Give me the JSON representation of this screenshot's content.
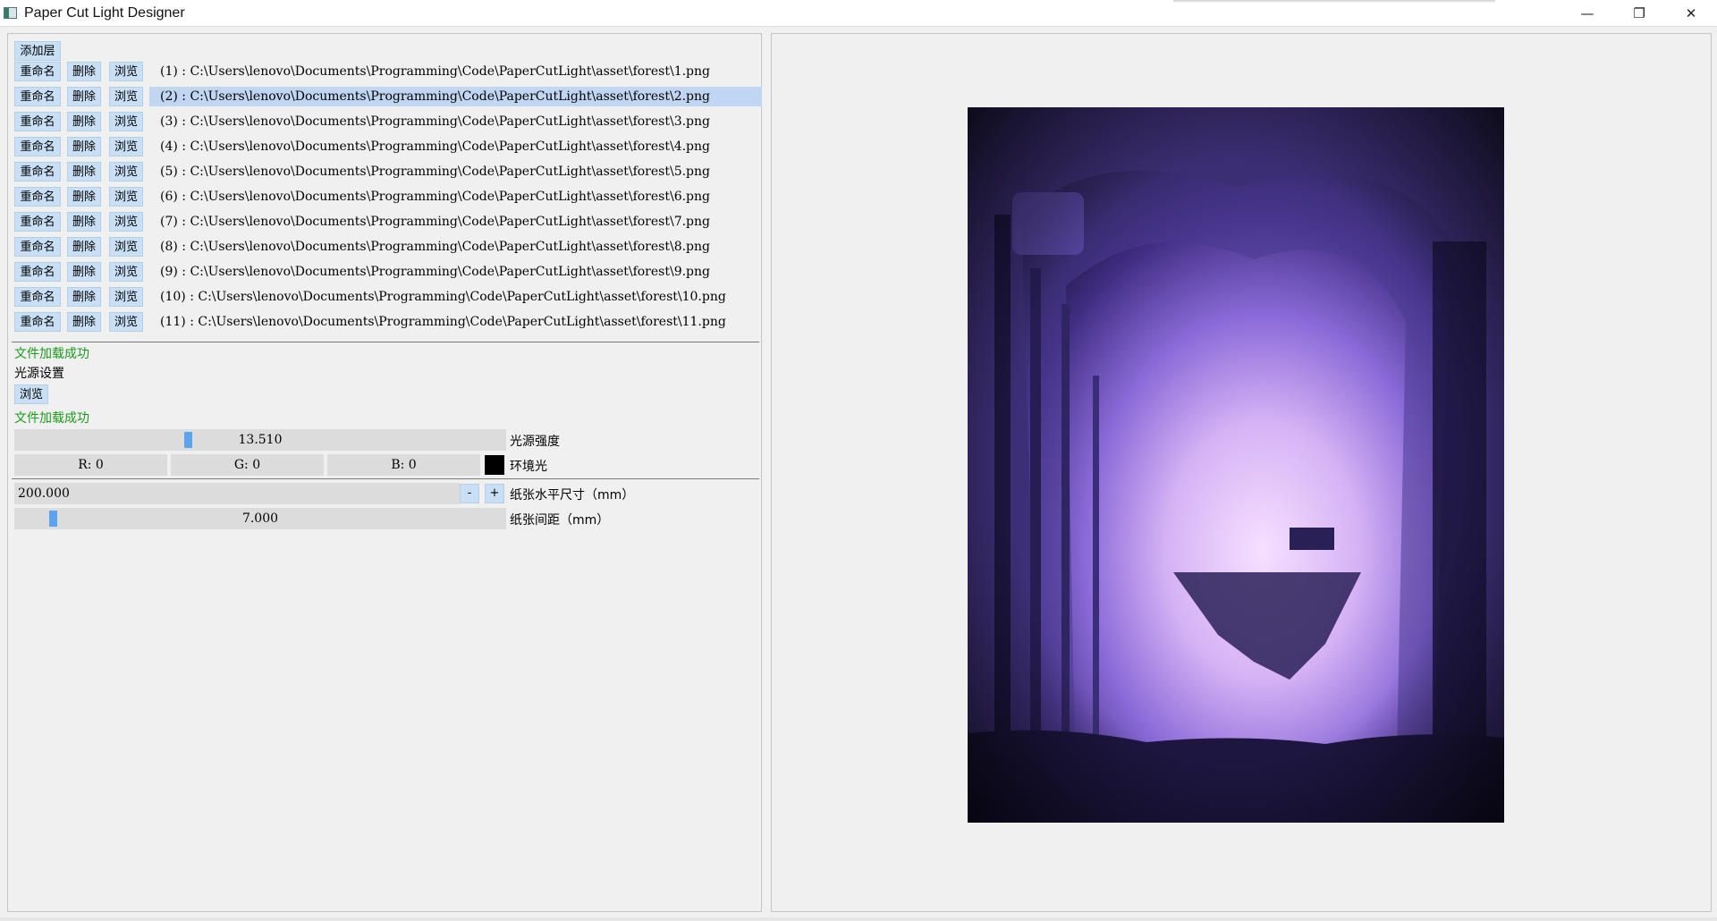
{
  "window": {
    "title": "Paper Cut Light Designer",
    "controls": {
      "minimize": "—",
      "restore": "❐",
      "close": "✕"
    }
  },
  "toolbar": {
    "add_layer": "添加层"
  },
  "layer_buttons": {
    "rename": "重命名",
    "delete": "删除",
    "browse": "浏览"
  },
  "layers": [
    {
      "path": "(1) : C:\\Users\\lenovo\\Documents\\Programming\\Code\\PaperCutLight\\asset\\forest\\1.png"
    },
    {
      "path": "(2) : C:\\Users\\lenovo\\Documents\\Programming\\Code\\PaperCutLight\\asset\\forest\\2.png"
    },
    {
      "path": "(3) : C:\\Users\\lenovo\\Documents\\Programming\\Code\\PaperCutLight\\asset\\forest\\3.png"
    },
    {
      "path": "(4) : C:\\Users\\lenovo\\Documents\\Programming\\Code\\PaperCutLight\\asset\\forest\\4.png"
    },
    {
      "path": "(5) : C:\\Users\\lenovo\\Documents\\Programming\\Code\\PaperCutLight\\asset\\forest\\5.png"
    },
    {
      "path": "(6) : C:\\Users\\lenovo\\Documents\\Programming\\Code\\PaperCutLight\\asset\\forest\\6.png"
    },
    {
      "path": "(7) : C:\\Users\\lenovo\\Documents\\Programming\\Code\\PaperCutLight\\asset\\forest\\7.png"
    },
    {
      "path": "(8) : C:\\Users\\lenovo\\Documents\\Programming\\Code\\PaperCutLight\\asset\\forest\\8.png"
    },
    {
      "path": "(9) : C:\\Users\\lenovo\\Documents\\Programming\\Code\\PaperCutLight\\asset\\forest\\9.png"
    },
    {
      "path": "(10) : C:\\Users\\lenovo\\Documents\\Programming\\Code\\PaperCutLight\\asset\\forest\\10.png"
    },
    {
      "path": "(11) : C:\\Users\\lenovo\\Documents\\Programming\\Code\\PaperCutLight\\asset\\forest\\11.png"
    }
  ],
  "selected_layer": 2,
  "status": {
    "layers_loaded": "文件加载成功"
  },
  "light": {
    "section_title": "光源设置",
    "browse": "浏览",
    "loaded": "文件加载成功",
    "intensity_value": "13.510",
    "intensity_label": "光源强度",
    "intensity_fraction": 0.35,
    "ambient": {
      "r": "R:  0",
      "g": "G:  0",
      "b": "B:  0",
      "label": "环境光",
      "color": "#000000"
    }
  },
  "paper": {
    "width_value": "200.000",
    "decrement": "-",
    "increment": "+",
    "width_label": "纸张水平尺寸（mm）",
    "spacing_value": "7.000",
    "spacing_label": "纸张间距（mm）",
    "spacing_fraction": 0.07
  },
  "colors": {
    "button_bg": "#c8dff5",
    "selected_row": "#c0d6f2",
    "success_text": "#1a9a1a",
    "slider_handle": "#5ea3f0",
    "preview_glow": "#f3d9ff",
    "preview_dark": "#1c1530"
  }
}
